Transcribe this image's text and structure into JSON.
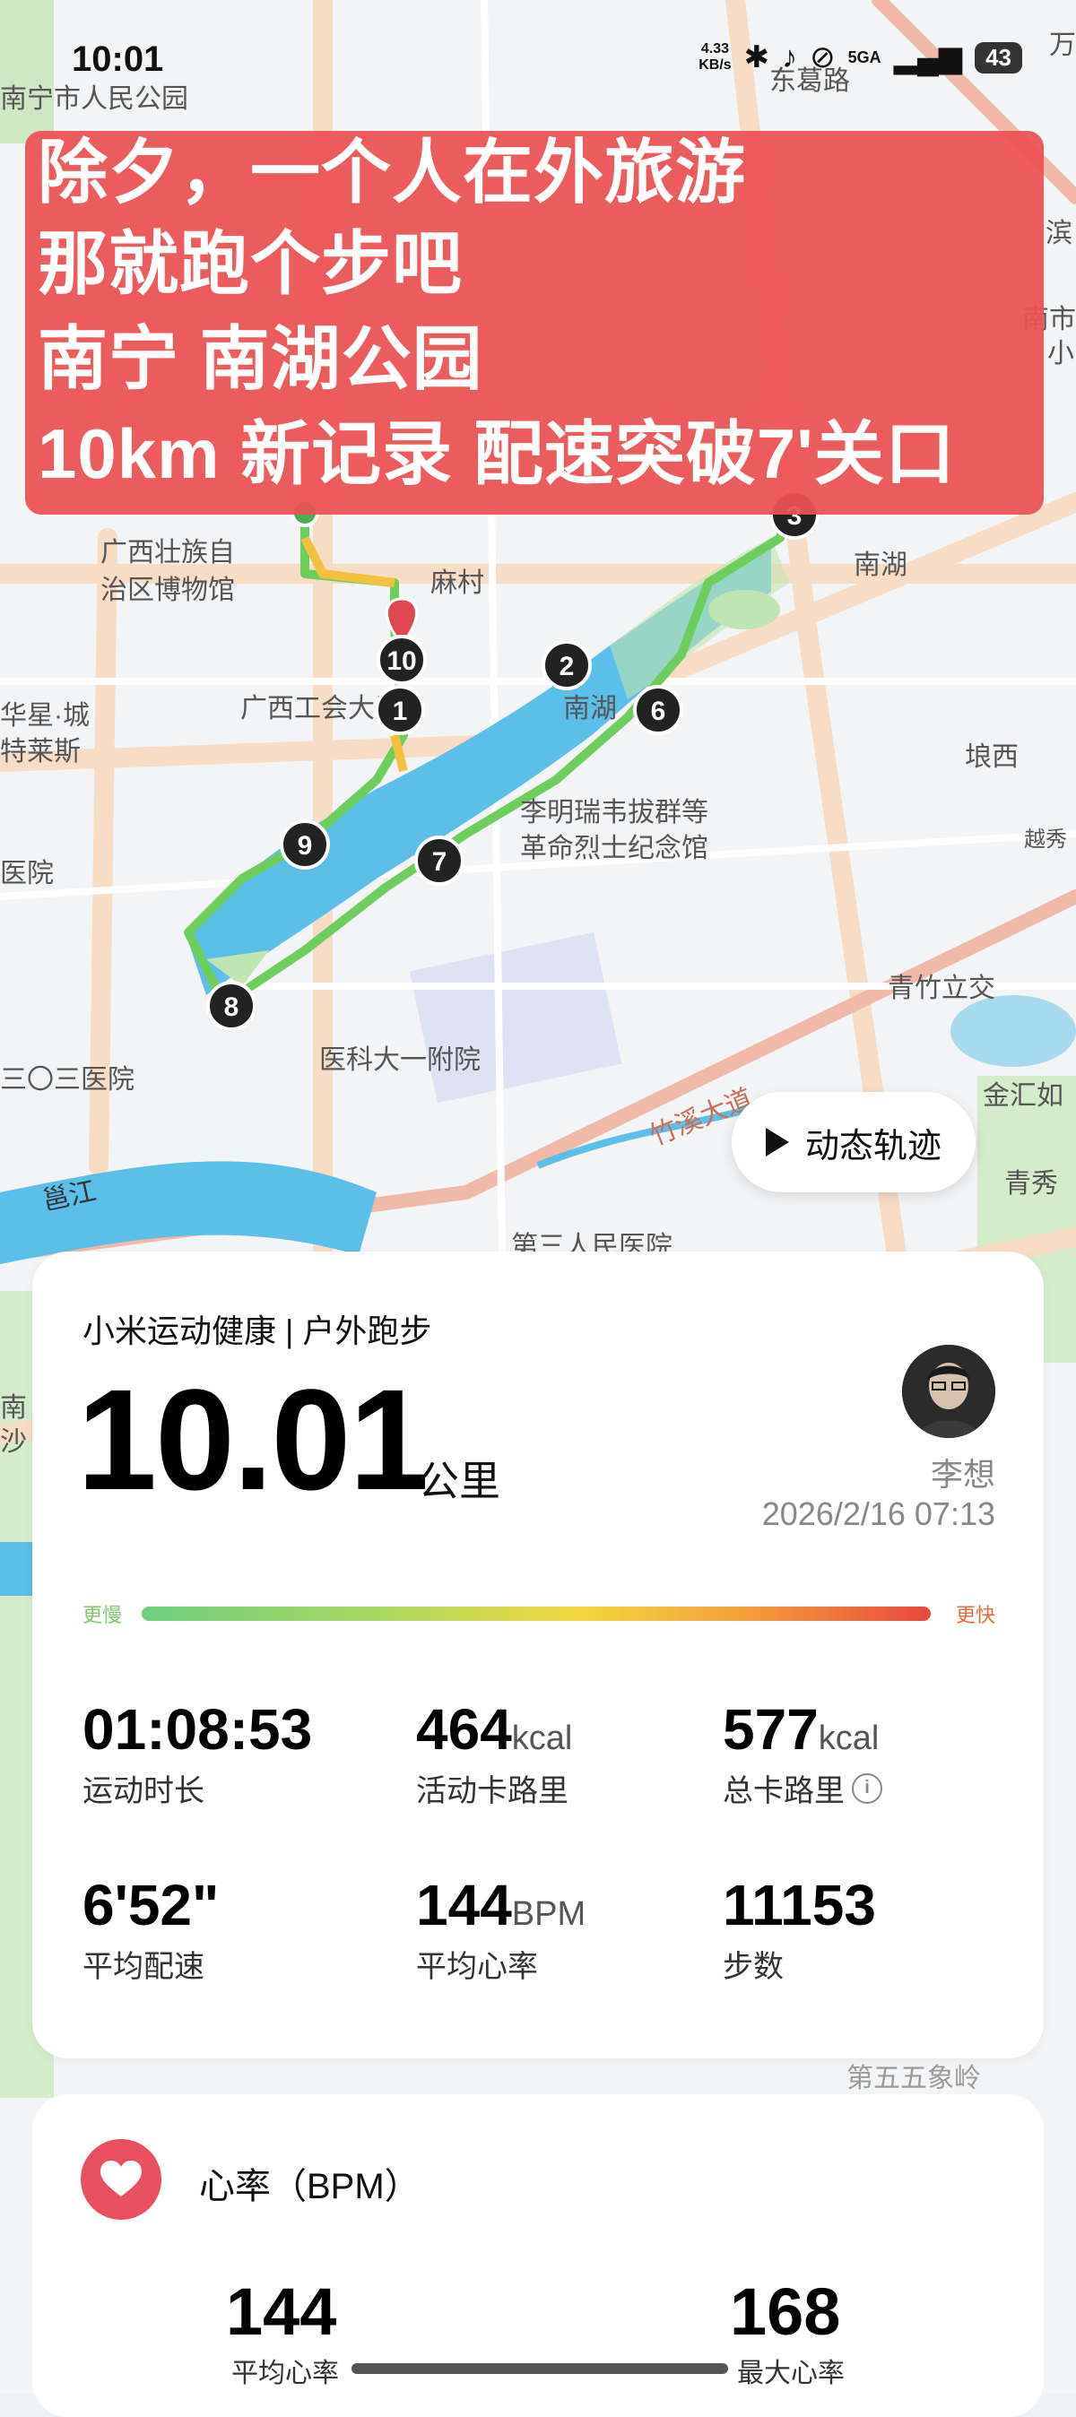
{
  "status_bar": {
    "time": "10:01",
    "net_speed_value": "4.33",
    "net_speed_unit": "KB/s",
    "signal_label": "5GA",
    "battery": "43"
  },
  "title_banner": {
    "lines": [
      "除夕，一个人在外旅游",
      "那就跑个步吧",
      "南宁 南湖公园",
      "10km 新记录 配速突破7'关口"
    ]
  },
  "map": {
    "labels": {
      "park_nanning": "南宁市人民公园",
      "street_dongge": "东葛路",
      "guangxi_museum_1": "广西壮族自",
      "guangxi_museum_2": "治区博物馆",
      "macun": "麻村",
      "nanhu_east": "南湖",
      "guangxi_union": "广西工会大厦",
      "nanhu_lake": "南湖",
      "huaxing_1": "华星·城",
      "huaxing_2": "特莱斯",
      "langxi": "埌西",
      "yuexiu": "越秀",
      "memorial_1": "李明瑞韦拔群等",
      "memorial_2": "革命烈士纪念馆",
      "hospital_left": "医院",
      "qingzhu": "青竹立交",
      "medical_hospital": "医科大一附院",
      "hospital_303": "三〇三医院",
      "zhuxi": "竹溪大道",
      "jinhui": "金汇如",
      "yongjiang": "邕江",
      "qingxiu": "青秀",
      "third_hospital": "第三人民医院",
      "wuxiang": "第五五象岭",
      "right_top": "万",
      "right_edge_1": "滨",
      "right_edge_2": "南市",
      "right_edge_3": "小",
      "left_edge_1": "南",
      "left_edge_2": "沙"
    },
    "km_markers": [
      "1",
      "2",
      "3",
      "6",
      "7",
      "8",
      "9",
      "10"
    ],
    "route_color": "#6dcf5b",
    "lake_color": "#5bbfe9",
    "green_color": "#bfe6b0"
  },
  "dynamic_track_button": {
    "label": "动态轨迹"
  },
  "summary": {
    "source": "小米运动健康 | 户外跑步",
    "distance": "10.01",
    "distance_unit": "公里",
    "user_name": "李想",
    "datetime": "2026/2/16 07:13",
    "pace_slow_label": "更慢",
    "pace_fast_label": "更快",
    "metrics": [
      {
        "value": "01:08:53",
        "unit": "",
        "label": "运动时长"
      },
      {
        "value": "464",
        "unit": "kcal",
        "label": "活动卡路里"
      },
      {
        "value": "577",
        "unit": "kcal",
        "label": "总卡路里"
      },
      {
        "value": "6'52\"",
        "unit": "",
        "label": "平均配速"
      },
      {
        "value": "144",
        "unit": "BPM",
        "label": "平均心率"
      },
      {
        "value": "11153",
        "unit": "",
        "label": "步数"
      }
    ]
  },
  "heart_rate": {
    "title": "心率（BPM）",
    "avg_value": "144",
    "avg_label": "平均心率",
    "max_value": "168",
    "max_label": "最大心率"
  }
}
